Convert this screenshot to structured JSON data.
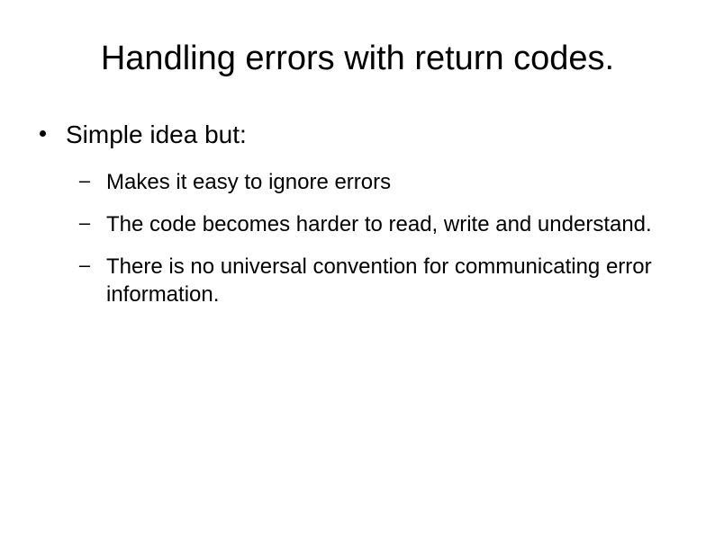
{
  "title": "Handling errors with return codes.",
  "lvl1_text": "Simple idea but:",
  "lvl2": {
    "0": "Makes it easy to ignore errors",
    "1": "The code becomes harder to read, write and understand.",
    "2": "There is no universal convention for communicating error information."
  }
}
